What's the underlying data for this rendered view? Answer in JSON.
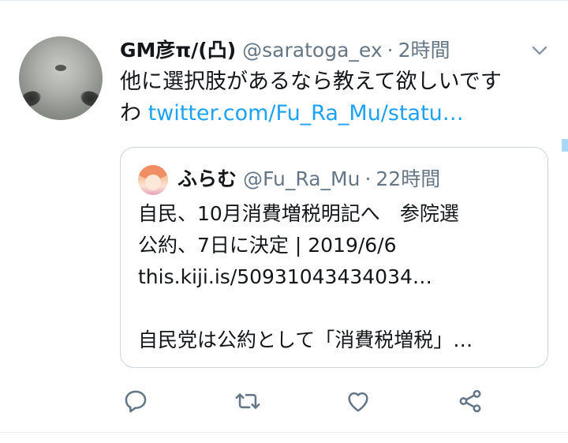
{
  "tweet": {
    "author": {
      "display_name": "GM彦π/(凸)",
      "handle": "@saratoga_ex",
      "separator": "·",
      "time": "2時間"
    },
    "text_line1": "他に選択肢があるなら教えて欲しいです",
    "text_line2_prefix": "わ ",
    "link": "twitter.com/Fu_Ra_Mu/statu…"
  },
  "quote": {
    "author": {
      "display_name": "ふらむ",
      "handle": "@Fu_Ra_Mu",
      "separator": "·",
      "time": "22時間"
    },
    "lines": [
      "自民、10月消費増税明記へ　参院選",
      "公約、7日に決定 | 2019/6/6",
      "this.kiji.is/50931043434034…",
      "",
      "自民党は公約として「消費税増税」…"
    ]
  },
  "icons": {
    "reply": "reply-icon",
    "retweet": "retweet-icon",
    "like": "like-icon",
    "share": "share-icon",
    "caret": "chevron-down-icon"
  },
  "colors": {
    "link": "#1da1f2",
    "secondary_text": "#657786",
    "primary_text": "#14171a",
    "border": "#ccd6dd",
    "icon": "#657786"
  }
}
